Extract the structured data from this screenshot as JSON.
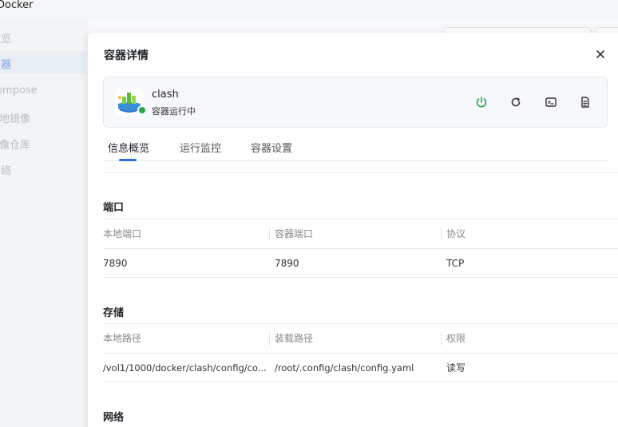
{
  "app": {
    "title": "Docker"
  },
  "sidebar": {
    "items": [
      {
        "label": "概览",
        "active": false
      },
      {
        "label": "容器",
        "active": true
      },
      {
        "label": "Compose",
        "active": false
      },
      {
        "label": "本地镜像",
        "active": false
      },
      {
        "label": "镜像仓库",
        "active": false
      },
      {
        "label": "网络",
        "active": false
      }
    ]
  },
  "modal": {
    "title": "容器详情",
    "close_icon": "close-icon"
  },
  "container": {
    "name": "clash",
    "status": "容器运行中",
    "status_color": "#22a845",
    "actions": [
      {
        "icon": "power-icon",
        "color": "#22a845"
      },
      {
        "icon": "restart-icon",
        "color": "#333333"
      },
      {
        "icon": "terminal-icon",
        "color": "#333333"
      },
      {
        "icon": "log-icon",
        "color": "#333333"
      }
    ]
  },
  "tabs": [
    {
      "label": "信息概览",
      "active": true
    },
    {
      "label": "运行监控",
      "active": false
    },
    {
      "label": "容器设置",
      "active": false
    }
  ],
  "accent_color": "#2f6fd9",
  "ports": {
    "title": "端口",
    "headers": [
      "本地端口",
      "容器端口",
      "协议"
    ],
    "rows": [
      [
        "7890",
        "7890",
        "TCP"
      ]
    ]
  },
  "storage": {
    "title": "存储",
    "headers": [
      "本地路径",
      "装载路径",
      "权限"
    ],
    "rows": [
      [
        "/vol1/1000/docker/clash/config/co...",
        "/root/.config/clash/config.yaml",
        "读写"
      ]
    ]
  },
  "network": {
    "title": "网络"
  }
}
